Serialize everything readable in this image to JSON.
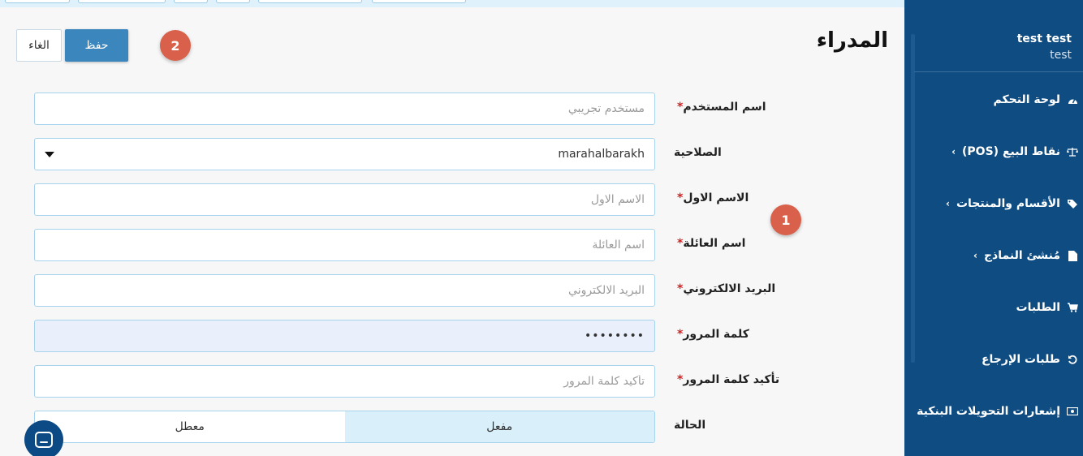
{
  "topbar": {},
  "main": {
    "title": "المدراء",
    "save_label": "حفظ",
    "cancel_label": "الغاء",
    "badges": [
      "1",
      "2"
    ]
  },
  "form": {
    "username": {
      "label": "اسم المستخدم",
      "required": "*",
      "value": "",
      "placeholder": "مستخدم تجريبي"
    },
    "role": {
      "label": "الصلاحية",
      "value": "marahalbarakh"
    },
    "first_name": {
      "label": "الاسم الاول",
      "required": "*",
      "placeholder": "الاسم الاول"
    },
    "last_name": {
      "label": "اسم العائلة",
      "required": "*",
      "placeholder": "اسم العائلة"
    },
    "email": {
      "label": "البريد الالكتروني",
      "required": "*",
      "placeholder": "البريد الالكتروني"
    },
    "password": {
      "label": "كلمة المرور",
      "required": "*",
      "value": "••••••••"
    },
    "confirm_password": {
      "label": "تأكيد كلمة المرور",
      "required": "*",
      "placeholder": "تأكيد كلمة المرور"
    },
    "status": {
      "label": "الحالة",
      "options": [
        "مفعل",
        "معطل"
      ],
      "selected": "مفعل"
    }
  },
  "sidebar": {
    "user_name": "test test",
    "user_role": "test",
    "items": [
      {
        "label": "لوحة التحكم",
        "icon": "dashboard-icon",
        "chevron": ""
      },
      {
        "label": "نقاط البيع (POS)",
        "icon": "scale-icon",
        "chevron": "‹"
      },
      {
        "label": "الأقسام والمنتجات",
        "icon": "tag-icon",
        "chevron": "‹"
      },
      {
        "label": "مُنشئ النماذج",
        "icon": "file-icon",
        "chevron": "‹"
      },
      {
        "label": "الطلبات",
        "icon": "cart-icon",
        "chevron": ""
      },
      {
        "label": "طلبات الإرجاع",
        "icon": "undo-icon",
        "chevron": ""
      },
      {
        "label": "إشعارات التحويلات البنكية",
        "icon": "money-icon",
        "chevron": ""
      }
    ]
  },
  "colors": {
    "sidebar_bg": "#0f4c81",
    "primary": "#3b87bd",
    "badge": "#d9604a",
    "field_border": "#a8d3ec"
  }
}
